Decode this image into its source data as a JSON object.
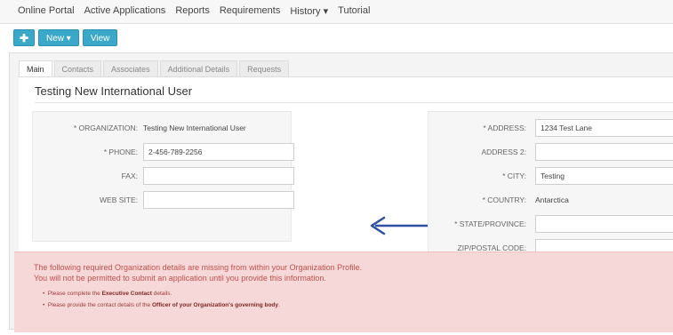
{
  "menu": [
    "Online Portal",
    "Active Applications",
    "Reports",
    "Requirements",
    "History ▾",
    "Tutorial"
  ],
  "toolbar": {
    "plus_label": "✚",
    "new_label": "New ▾",
    "view_label": "View"
  },
  "tabs": [
    "Main",
    "Contacts",
    "Associates",
    "Additional Details",
    "Requests"
  ],
  "page_title": "Testing New International User",
  "left": {
    "organization_label": "* ORGANIZATION:",
    "organization_value": "Testing New International User",
    "phone_label": "* PHONE:",
    "phone_value": "2-456-789-2256",
    "fax_label": "FAX:",
    "fax_value": "",
    "website_label": "WEB SITE:",
    "website_value": ""
  },
  "right": {
    "address_label": "* ADDRESS:",
    "address_value": "1234 Test Lane",
    "address2_label": "ADDRESS 2:",
    "address2_value": "",
    "city_label": "* CITY:",
    "city_value": "Testing",
    "country_label": "* COUNTRY:",
    "country_value": "Antarctica",
    "state_label": "* STATE/PROVINCE:",
    "state_value": "",
    "zip_label": "ZIP/POSTAL CODE:",
    "zip_value": ""
  },
  "alert": {
    "line1": "The following required Organization details are missing from within your Organization Profile.",
    "line2": "You will not be permitted to submit an application until you provide this information.",
    "bullet1_pre": "Please complete the ",
    "bullet1_bold": "Executive Contact",
    "bullet1_post": " details.",
    "bullet2_pre": "Please provide the contact details of the ",
    "bullet2_bold": "Officer of your Organization's governing body",
    "bullet2_post": "."
  },
  "colors": {
    "accent": "#39a8c9",
    "arrow": "#2f4fa0",
    "alert_bg": "#f6d8d8",
    "alert_text": "#c0504d"
  },
  "icons": {
    "arrow": "arrow-left-icon"
  }
}
